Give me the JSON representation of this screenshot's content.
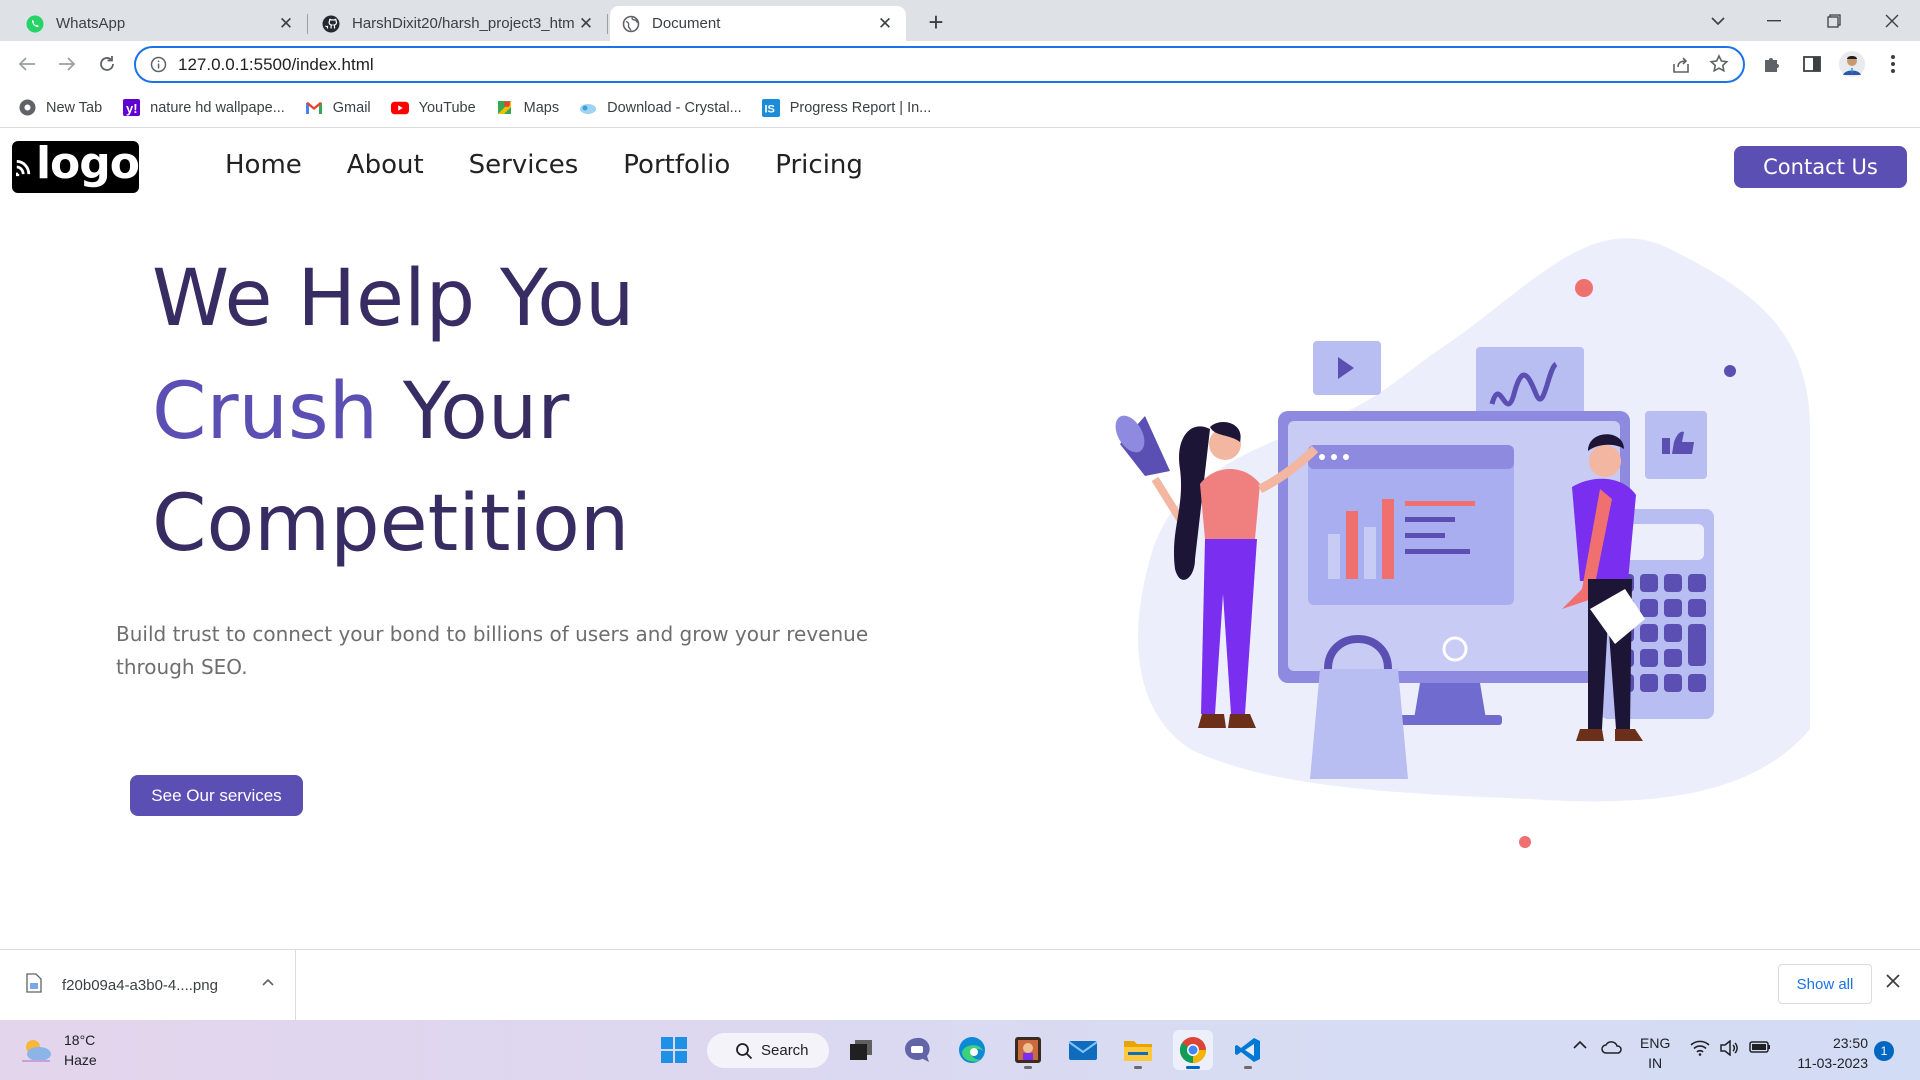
{
  "browser": {
    "tabs": [
      {
        "title": "WhatsApp",
        "icon": "whatsapp-icon",
        "active": false
      },
      {
        "title": "HarshDixit20/harsh_project3_htm",
        "icon": "github-icon",
        "active": false
      },
      {
        "title": "Document",
        "icon": "globe-icon",
        "active": true
      }
    ],
    "url": "127.0.0.1:5500/index.html",
    "bookmarks": [
      {
        "label": "New Tab",
        "icon": "chrome-newtab-icon"
      },
      {
        "label": "nature hd wallpape...",
        "icon": "yahoo-icon"
      },
      {
        "label": "Gmail",
        "icon": "gmail-icon"
      },
      {
        "label": "YouTube",
        "icon": "youtube-icon"
      },
      {
        "label": "Maps",
        "icon": "maps-icon"
      },
      {
        "label": "Download - Crystal...",
        "icon": "crystal-icon"
      },
      {
        "label": "Progress Report | In...",
        "icon": "is-icon"
      }
    ]
  },
  "site": {
    "logo_text": "logo",
    "nav": [
      "Home",
      "About",
      "Services",
      "Portfolio",
      "Pricing"
    ],
    "contact_label": "Contact Us",
    "hero": {
      "line1": "We Help You",
      "line2_accent": "Crush",
      "line2_rest": " Your",
      "line3": "Competition"
    },
    "subtitle": "Build trust to connect your bond to billions of users and grow your revenue through SEO.",
    "cta_label": "See Our services",
    "colors": {
      "primary": "#5b4fb3",
      "heading": "#372d63",
      "body_text": "#6e6e6e"
    }
  },
  "download_bar": {
    "filename": "f20b09a4-a3b0-4....png",
    "show_all": "Show all"
  },
  "taskbar": {
    "weather_temp": "18°C",
    "weather_desc": "Haze",
    "search_label": "Search",
    "lang_line1": "ENG",
    "lang_line2": "IN",
    "time": "23:50",
    "date": "11-03-2023",
    "notifications": "1"
  }
}
